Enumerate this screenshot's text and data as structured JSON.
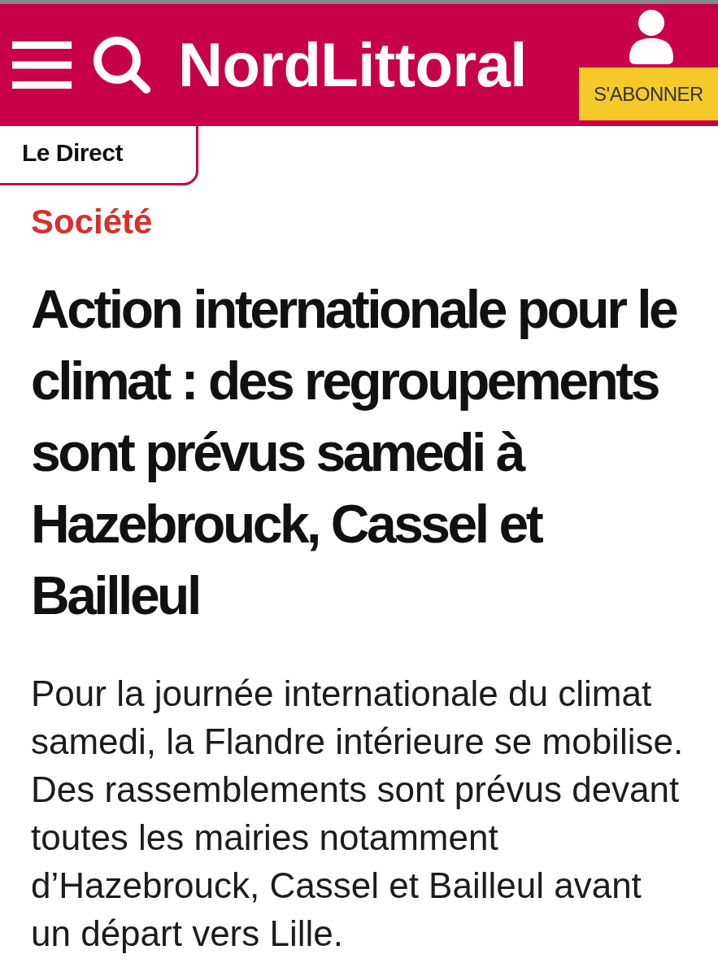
{
  "header": {
    "logo": "NordLittoral",
    "subscribe_button": "S'ABONNER"
  },
  "live_tab": {
    "label": "Le Direct"
  },
  "article": {
    "category": "Société",
    "headline": "Action internationale pour le climat : des regroupements sont prévus samedi à Hazebrouck, Cassel et Bailleul",
    "lead": "Pour la journée internationale du climat samedi, la Flandre intérieure se mobilise. Des rassemblements sont prévus devant toutes les mairies notamment d’Hazebrouck, Cassel et Bailleul avant un départ vers Lille."
  }
}
